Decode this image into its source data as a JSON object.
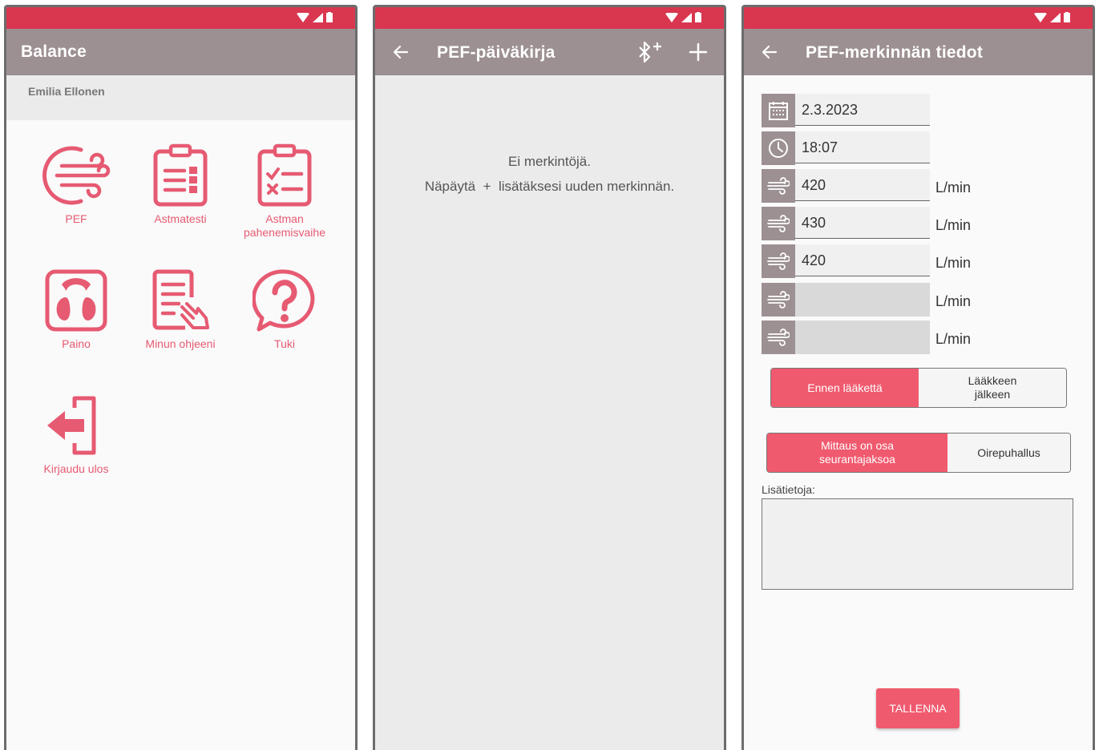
{
  "colors": {
    "statusbar": "#d93650",
    "appbar": "#9d9092",
    "accent": "#e65a72",
    "button": "#f05a6e"
  },
  "screen1": {
    "title": "Balance",
    "user": "Emilia Ellonen",
    "items": [
      {
        "label": "PEF",
        "icon": "wind-icon"
      },
      {
        "label": "Astmatesti",
        "icon": "clipboard-list-icon"
      },
      {
        "label": "Astman pahenemisvaihe",
        "icon": "clipboard-check-icon"
      },
      {
        "label": "Paino",
        "icon": "scale-icon"
      },
      {
        "label": "Minun ohjeeni",
        "icon": "document-hand-icon"
      },
      {
        "label": "Tuki",
        "icon": "question-bubble-icon"
      },
      {
        "label": "Kirjaudu ulos",
        "icon": "logout-icon"
      }
    ]
  },
  "screen2": {
    "title": "PEF-päiväkirja",
    "empty_line1": "Ei merkintöjä.",
    "empty_line2": "Näpäytä  +  lisätäksesi uuden merkinnän."
  },
  "screen3": {
    "title": "PEF-merkinnän tiedot",
    "date": "2.3.2023",
    "time": "18:07",
    "unit": "L/min",
    "readings": [
      "420",
      "430",
      "420",
      "",
      ""
    ],
    "med_toggle": {
      "before": "Ennen lääkettä",
      "after": "Lääkkeen jälkeen",
      "selected": "before"
    },
    "type_toggle": {
      "followup": "Mittaus on osa seurantajaksoa",
      "symptom": "Oirepuhallus",
      "selected": "followup"
    },
    "notes_label": "Lisätietoja:",
    "save": "TALLENNA"
  }
}
